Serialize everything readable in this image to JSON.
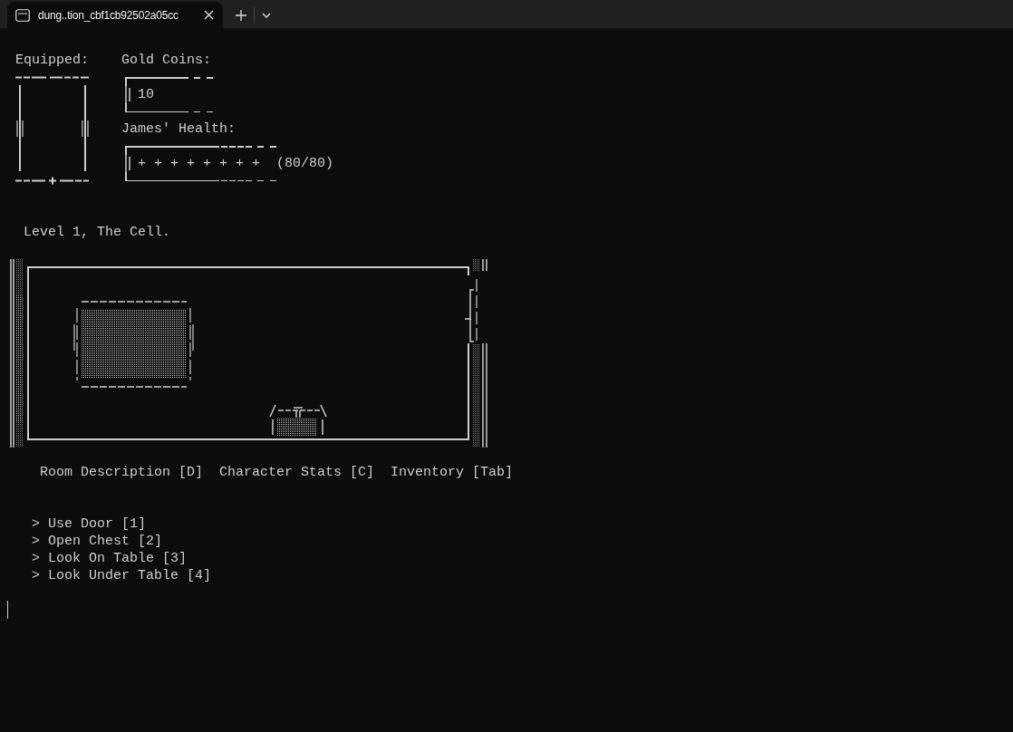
{
  "tab": {
    "title": "dung..tion_cbf1cb92502a05cc",
    "selected": true
  },
  "equipped": {
    "label": "Equipped:"
  },
  "gold": {
    "label": "Gold Coins:",
    "value": "10"
  },
  "health": {
    "label": "James' Health:",
    "bar": "+ + + + + + + +",
    "reading": "(80/80)"
  },
  "level_title": "Level 1, The Cell.",
  "menu": [
    {
      "label": "Room Description [D]"
    },
    {
      "label": "Character Stats [C]"
    },
    {
      "label": "Inventory [Tab]"
    }
  ],
  "actions": [
    {
      "label": "> Use Door [1]"
    },
    {
      "label": "> Open Chest [2]"
    },
    {
      "label": "> Look On Table [3]"
    },
    {
      "label": "> Look Under Table [4]"
    }
  ]
}
